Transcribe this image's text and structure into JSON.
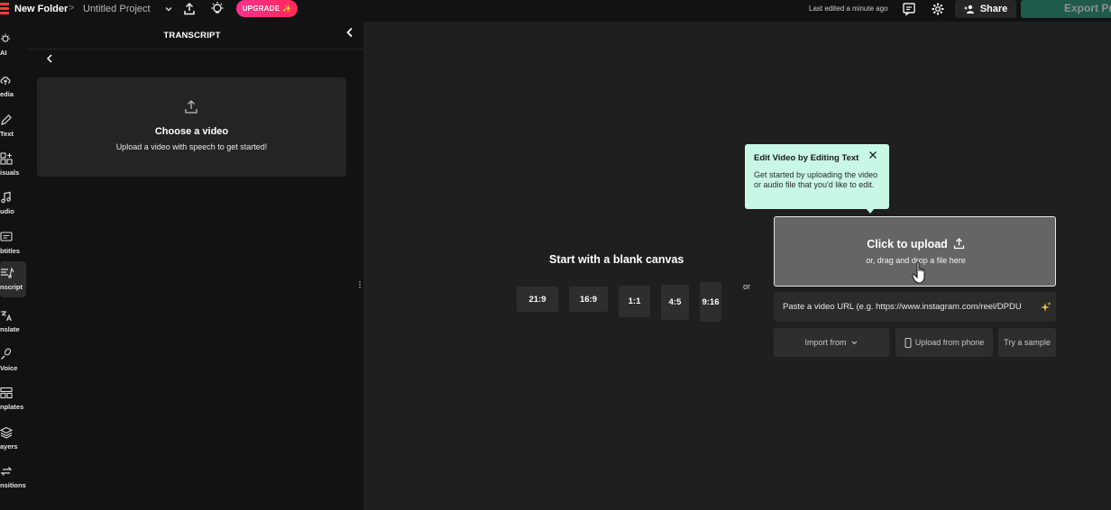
{
  "topbar": {
    "folder": "New Folder",
    "separator": ">",
    "project": "Untitled Project",
    "upgrade_label": "UPGRADE",
    "upgrade_sparkle": "✨",
    "last_edited": "Last edited a minute ago",
    "share_label": "Share",
    "export_label": "Export Pr",
    "brand_color": "#ff3b3b",
    "export_color": "#1f5b4a"
  },
  "rail": {
    "items": [
      {
        "label": "AI",
        "icon": "sparkle-bulb-icon"
      },
      {
        "label": "edia",
        "icon": "cloud-upload-icon"
      },
      {
        "label": "Text",
        "icon": "pen-icon"
      },
      {
        "label": "isuals",
        "icon": "shapes-icon"
      },
      {
        "label": "udio",
        "icon": "music-note-icon"
      },
      {
        "label": "btitles",
        "icon": "subtitles-icon"
      },
      {
        "label": "nscript",
        "icon": "transcript-icon",
        "active": true
      },
      {
        "label": "nslate",
        "icon": "translate-icon"
      },
      {
        "label": "Voice",
        "icon": "microphone-icon"
      },
      {
        "label": "nplates",
        "icon": "templates-icon"
      },
      {
        "label": "ayers",
        "icon": "layers-icon"
      },
      {
        "label": "nsitions",
        "icon": "transitions-icon"
      }
    ]
  },
  "panel": {
    "title": "TRANSCRIPT",
    "card_title": "Choose a video",
    "card_subtitle": "Upload a video with speech to get started!"
  },
  "main": {
    "blank_canvas_title": "Start with a blank canvas",
    "ratios": [
      "21:9",
      "16:9",
      "1:1",
      "4:5",
      "9:16"
    ],
    "or_label": "or",
    "upload_title": "Click to upload",
    "upload_subtitle": "or, drag and drop a file here",
    "url_placeholder": "Paste a video URL (e.g. https://www.instagram.com/reel/DPDU",
    "import_label": "Import from",
    "phone_label": "Upload from phone",
    "sample_label": "Try a sample"
  },
  "tooltip": {
    "title": "Edit Video by Editing Text",
    "body": "Get started by uploading the video or audio file that you'd like to edit.",
    "bg_color": "#c8f7e6"
  }
}
